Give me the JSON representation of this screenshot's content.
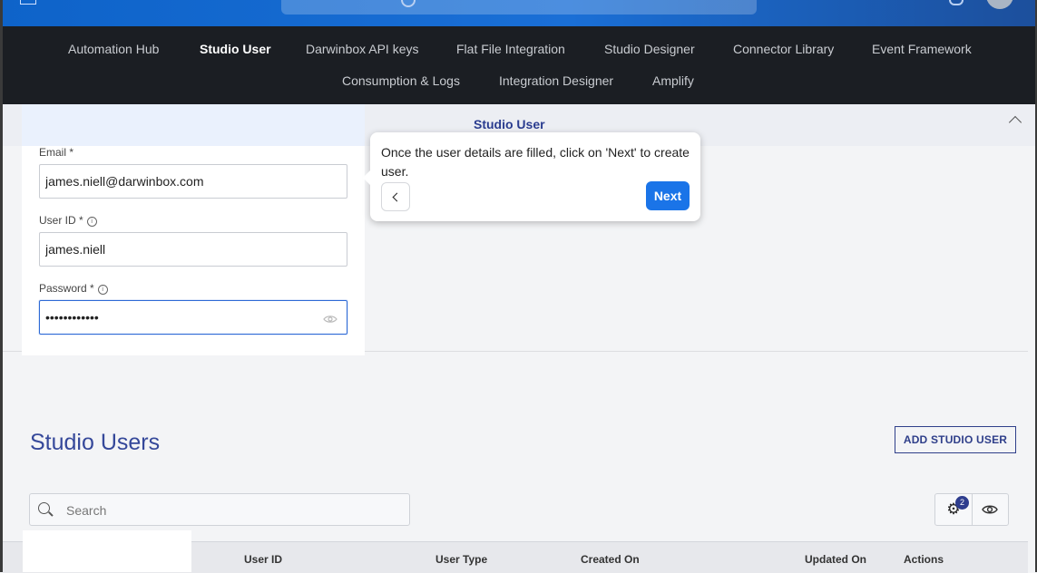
{
  "modules": {
    "items": [
      {
        "label": "Automation Hub",
        "active": false
      },
      {
        "label": "Studio User",
        "active": true
      },
      {
        "label": "Darwinbox API keys",
        "active": false
      },
      {
        "label": "Flat File Integration",
        "active": false
      },
      {
        "label": "Studio Designer",
        "active": false
      },
      {
        "label": "Connector Library",
        "active": false
      },
      {
        "label": "Event Framework",
        "active": false
      },
      {
        "label": "Consumption & Logs",
        "active": false
      },
      {
        "label": "Integration Designer",
        "active": false
      },
      {
        "label": "Amplify",
        "active": false
      }
    ]
  },
  "section": {
    "title": "Studio User"
  },
  "form": {
    "email_label": "Email *",
    "email_value": "james.niell@darwinbox.com",
    "userid_label": "User ID *",
    "userid_value": "james.niell",
    "password_label": "Password *",
    "password_value": "••••••••••••",
    "info_glyph": "i"
  },
  "tour": {
    "message": "Once the user details are filled, click on 'Next' to create user.",
    "next_label": "Next"
  },
  "list": {
    "title": "Studio Users",
    "add_button": "ADD STUDIO USER",
    "search_placeholder": "Search",
    "filter_count": "2",
    "columns": [
      "User ID",
      "User Type",
      "Created On",
      "Updated On",
      "Actions"
    ]
  },
  "colors": {
    "brand_blue": "#1a6fd6",
    "nav_bg": "#1b1e23",
    "accent_indigo": "#2f3f8a",
    "next_button": "#1a74e8"
  }
}
